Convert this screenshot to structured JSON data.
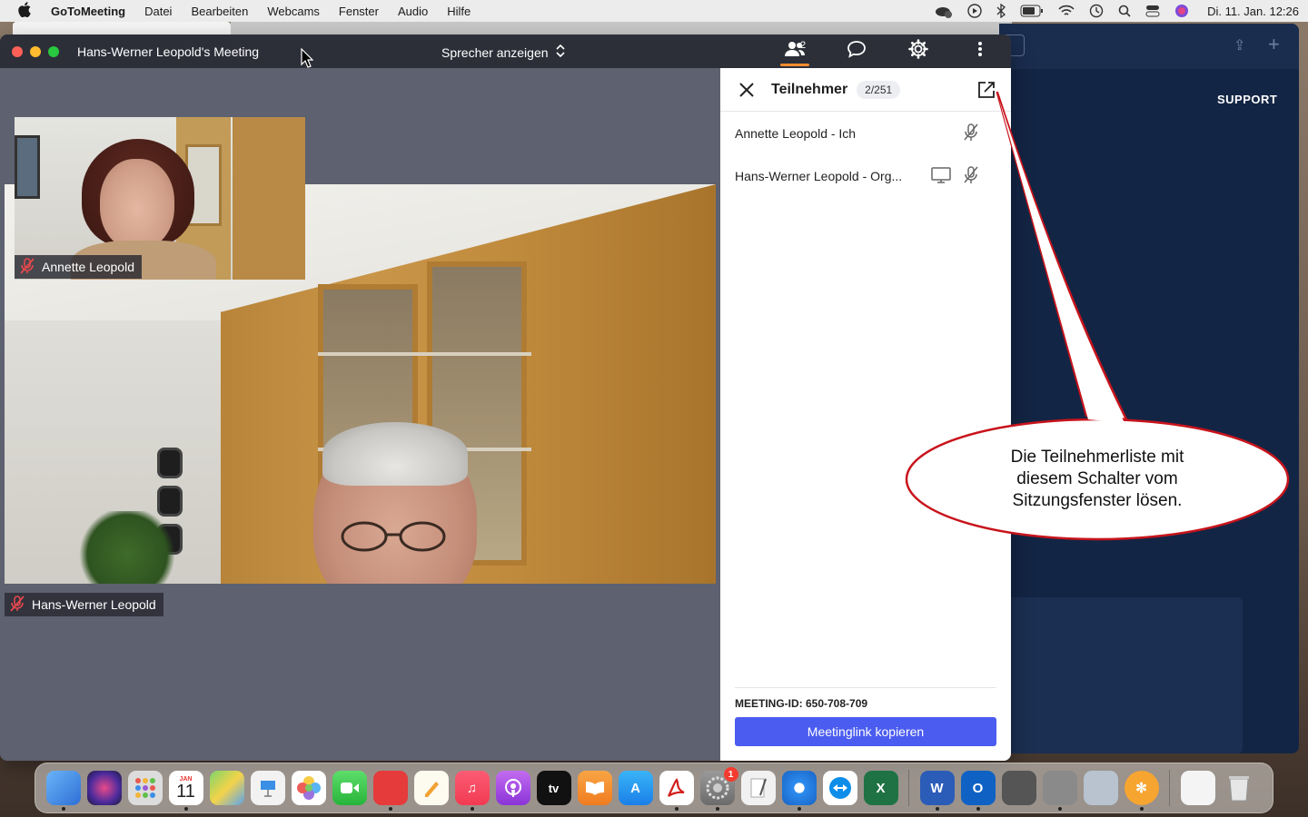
{
  "menubar": {
    "app_name": "GoToMeeting",
    "items": [
      "Datei",
      "Bearbeiten",
      "Webcams",
      "Fenster",
      "Audio",
      "Hilfe"
    ],
    "clock": "Di. 11. Jan.  12:26"
  },
  "background_window": {
    "support_label": "SUPPORT"
  },
  "meeting_window": {
    "title": "Hans-Werner Leopold's Meeting",
    "view_mode": "Sprecher anzeigen",
    "participants_count_badge": "2",
    "accent_color": "#f68d2e"
  },
  "videos": {
    "main": {
      "name": "Hans-Werner Leopold",
      "muted": true
    },
    "thumbnail": {
      "name": "Annette Leopold",
      "muted": true
    }
  },
  "participants_panel": {
    "title": "Teilnehmer",
    "count": "2/251",
    "participants": [
      {
        "name": "Annette Leopold - Ich",
        "screen_sharing": false,
        "muted": true
      },
      {
        "name": "Hans-Werner Leopold - Org...",
        "screen_sharing": true,
        "muted": true
      }
    ],
    "meeting_id_label": "MEETING-ID: 650-708-709",
    "copy_button_label": "Meetinglink kopieren",
    "button_color": "#4b5cf0"
  },
  "callout": {
    "lines": [
      "Die Teilnehmerliste mit",
      "diesem Schalter vom",
      "Sitzungsfenster lösen."
    ]
  },
  "dock": {
    "calendar_month": "JAN",
    "calendar_day": "11",
    "settings_badge": "1"
  }
}
